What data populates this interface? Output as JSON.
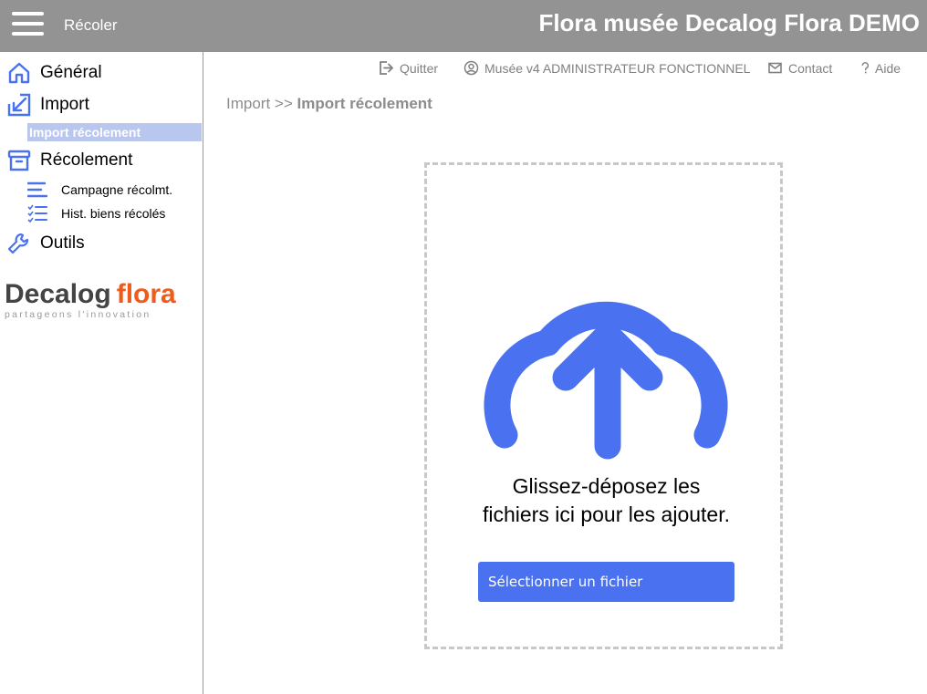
{
  "header": {
    "app_name": "Récoler",
    "title": "Flora musée Decalog Flora DEMO"
  },
  "sidebar": {
    "items": [
      {
        "label": "Général",
        "icon": "home-icon"
      },
      {
        "label": "Import",
        "icon": "import-arrow-icon"
      },
      {
        "label": "Import récolement",
        "icon": ""
      },
      {
        "label": "Récolement",
        "icon": "archive-box-icon"
      },
      {
        "label": "Campagne récolmt.",
        "icon": "list-lines-icon"
      },
      {
        "label": "Hist. biens récolés",
        "icon": "checklist-icon"
      },
      {
        "label": "Outils",
        "icon": "wrench-icon"
      }
    ],
    "logo": {
      "word1": "Decalog",
      "word2": "flora",
      "tagline": "partageons l'innovation"
    }
  },
  "toplinks": {
    "quit": "Quitter",
    "user": "Musée v4 ADMINISTRATEUR FONCTIONNEL",
    "contact": "Contact",
    "help": "Aide"
  },
  "breadcrumb": {
    "parent": "Import",
    "separator": ">>",
    "current": "Import récolement"
  },
  "dropzone": {
    "text": "Glissez-déposez les fichiers ici pour les ajouter.",
    "button_label": "Sélectionner un fichier"
  },
  "colors": {
    "accent": "#4a72f0",
    "topbar": "#939393",
    "logo_orange": "#f05a1a"
  }
}
